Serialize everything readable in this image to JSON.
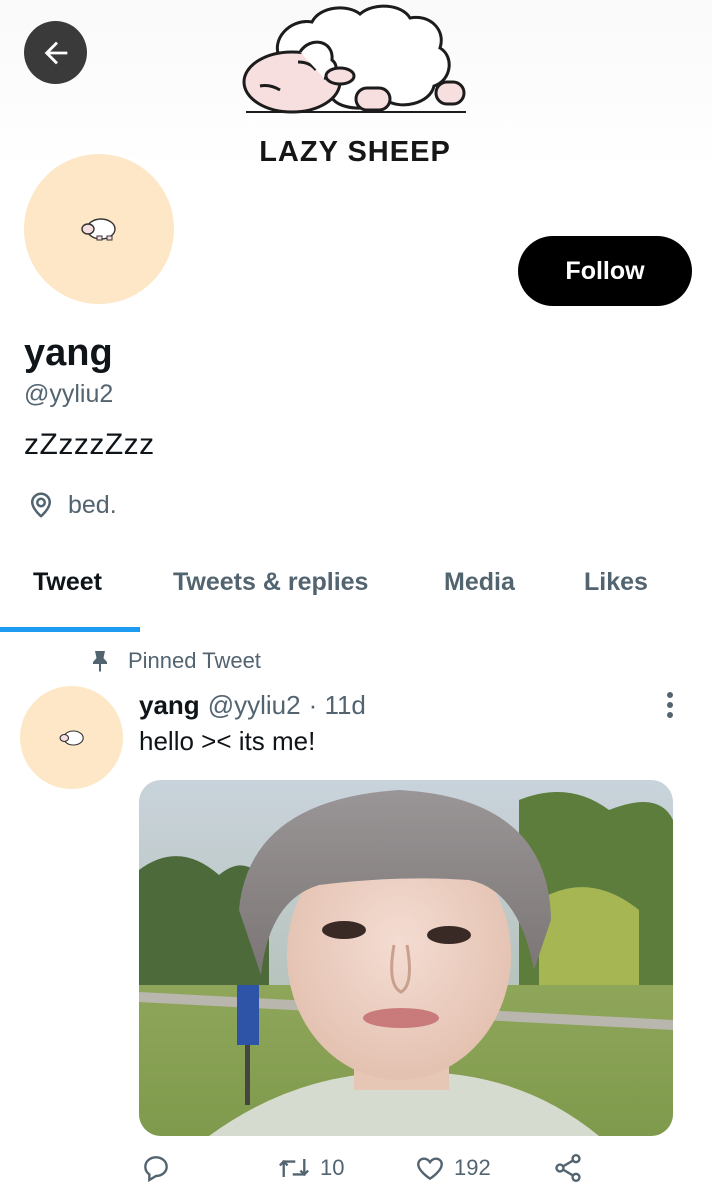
{
  "banner": {
    "text": "LAZY SHEEP"
  },
  "nav": {
    "back_icon": "arrow-left-icon"
  },
  "profile": {
    "follow_label": "Follow",
    "name": "yang",
    "handle": "@yyliu2",
    "bio": "zZzzzZzz",
    "location": "bed."
  },
  "tabs": [
    {
      "label": "Tweet",
      "active": true
    },
    {
      "label": "Tweets & replies",
      "active": false
    },
    {
      "label": "Media",
      "active": false
    },
    {
      "label": "Likes",
      "active": false
    }
  ],
  "tweet": {
    "pinned_label": "Pinned Tweet",
    "name": "yang",
    "handle": "@yyliu2",
    "time": "· 11d",
    "text": "hello >< its me!",
    "retweets": "10",
    "likes": "192"
  },
  "colors": {
    "accent": "#1d9bf0",
    "avatar_bg": "#fde7c6",
    "muted": "#536471"
  }
}
